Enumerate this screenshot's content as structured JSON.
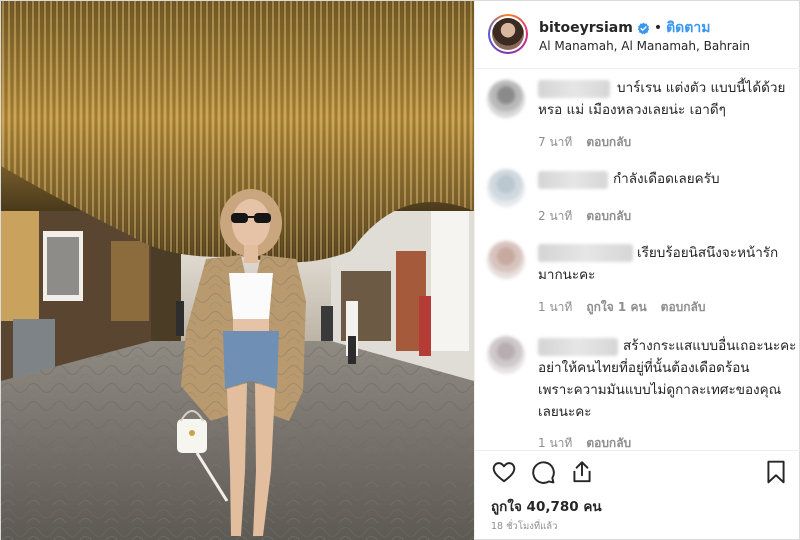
{
  "header": {
    "username": "bitoeyrsiam",
    "separator": "•",
    "follow_label": "ติดตาม",
    "location": "Al Manamah, Al Manamah, Bahrain"
  },
  "comments": [
    {
      "lines": [
        "บาร์เรน แต่งตัว แบบนี้ได้ด้วย",
        "หรอ แม่ เมืองหลวงเลยน่ะ เอาดีๆ"
      ],
      "time": "7 นาที",
      "likes": "",
      "reply": "ตอบกลับ"
    },
    {
      "lines": [
        "กำลังเดือดเลยครับ"
      ],
      "time": "2 นาที",
      "likes": "",
      "reply": "ตอบกลับ"
    },
    {
      "lines": [
        "เรียบร้อยนิสนึงจะหน้ารัก",
        "มากนะคะ"
      ],
      "time": "1 นาที",
      "likes": "ถูกใจ 1 คน",
      "reply": "ตอบกลับ"
    },
    {
      "lines": [
        "สร้างกระแสแบบอื่นเถอะนะคะ",
        "อย่าให้คนไทยที่อยู่ที่นั้นต้องเดือดร้อน",
        "เพราะความมันแบบไม่ดูกาละเทศะของคุณ",
        "เลยนะคะ"
      ],
      "time": "1 นาที",
      "likes": "",
      "reply": "ตอบกลับ"
    }
  ],
  "footer": {
    "likes_label": "ถูกใจ 40,780 คน",
    "timestamp": "18 ชั่วโมงที่แล้ว"
  },
  "icons": {
    "like": "heart-icon",
    "comment": "comment-icon",
    "share": "share-icon",
    "save": "bookmark-icon",
    "verified": "verified-badge-icon"
  },
  "colors": {
    "follow": "#3897f0",
    "verified": "#3897f0",
    "muted": "#8e8e8e",
    "text": "#262626"
  }
}
